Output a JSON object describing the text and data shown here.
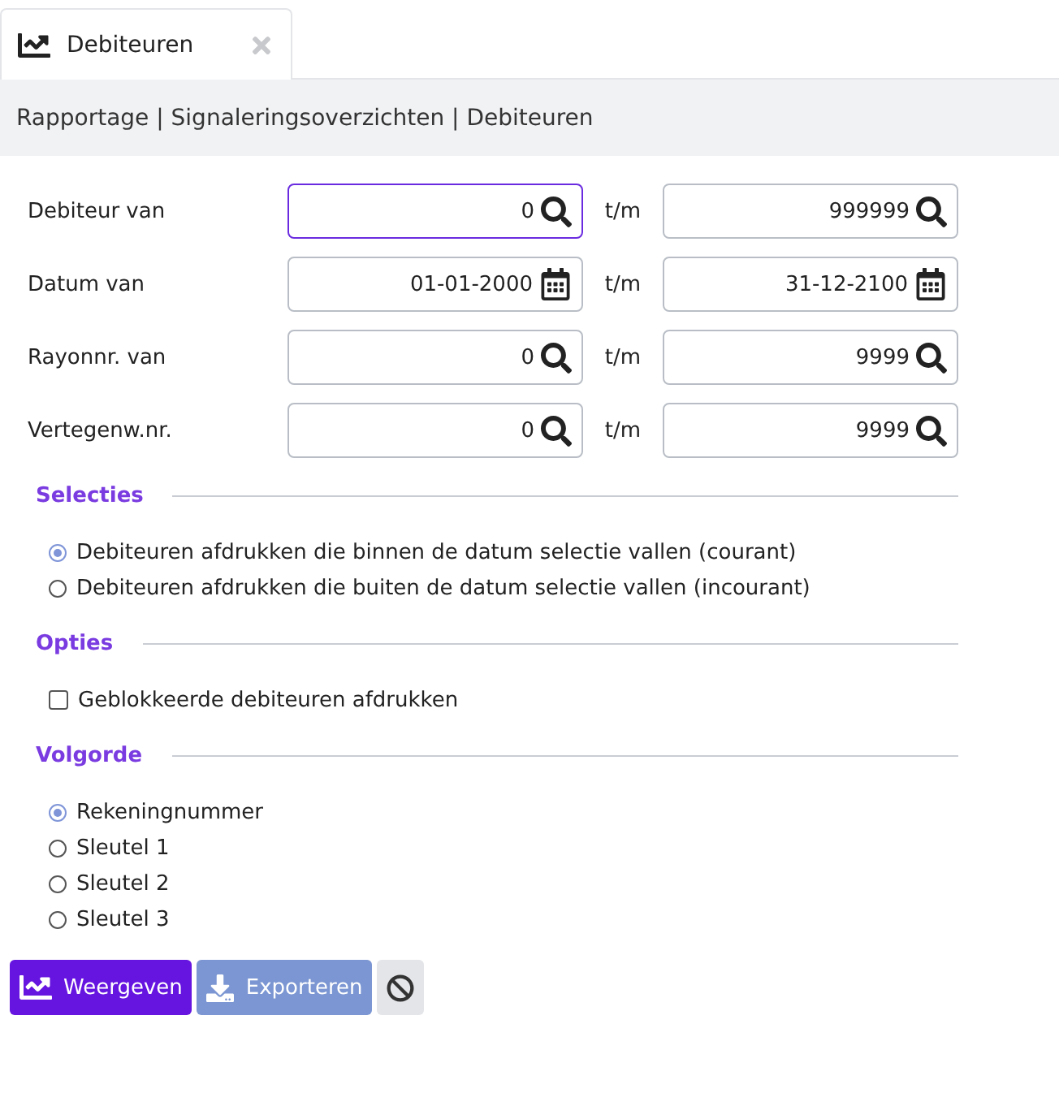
{
  "tab": {
    "label": "Debiteuren",
    "selected": true
  },
  "breadcrumb": "Rapportage | Signaleringsoverzichten | Debiteuren",
  "filters": [
    {
      "label": "Debiteur van",
      "separator": "t/m",
      "from": {
        "value": "0",
        "kind": "search",
        "focused": true
      },
      "to": {
        "value": "999999",
        "kind": "search",
        "focused": false
      }
    },
    {
      "label": "Datum van",
      "separator": "t/m",
      "from": {
        "value": "01-01-2000",
        "kind": "date",
        "focused": false
      },
      "to": {
        "value": "31-12-2100",
        "kind": "date",
        "focused": false
      }
    },
    {
      "label": "Rayonnr. van",
      "separator": "t/m",
      "from": {
        "value": "0",
        "kind": "search",
        "focused": false
      },
      "to": {
        "value": "9999",
        "kind": "search",
        "focused": false
      }
    },
    {
      "label": "Vertegenw.nr.",
      "separator": "t/m",
      "from": {
        "value": "0",
        "kind": "search",
        "focused": false
      },
      "to": {
        "value": "9999",
        "kind": "search",
        "focused": false
      }
    }
  ],
  "sections": [
    {
      "title": "Selecties",
      "kind": "radio",
      "items": [
        {
          "label": "Debiteuren afdrukken die binnen de datum selectie vallen (courant)",
          "selected": true
        },
        {
          "label": "Debiteuren afdrukken die buiten de datum selectie vallen (incourant)",
          "selected": false
        }
      ]
    },
    {
      "title": "Opties",
      "kind": "checkbox",
      "items": [
        {
          "label": "Geblokkeerde debiteuren afdrukken",
          "checked": false
        }
      ]
    },
    {
      "title": "Volgorde",
      "kind": "radio",
      "items": [
        {
          "label": "Rekeningnummer",
          "selected": true
        },
        {
          "label": "Sleutel 1",
          "selected": false
        },
        {
          "label": "Sleutel 2",
          "selected": false
        },
        {
          "label": "Sleutel 3",
          "selected": false
        }
      ]
    }
  ],
  "buttons": [
    {
      "label": "Weergeven",
      "kind": "show"
    },
    {
      "label": "Exporteren",
      "kind": "export"
    },
    {
      "kind": "cancel"
    }
  ]
}
